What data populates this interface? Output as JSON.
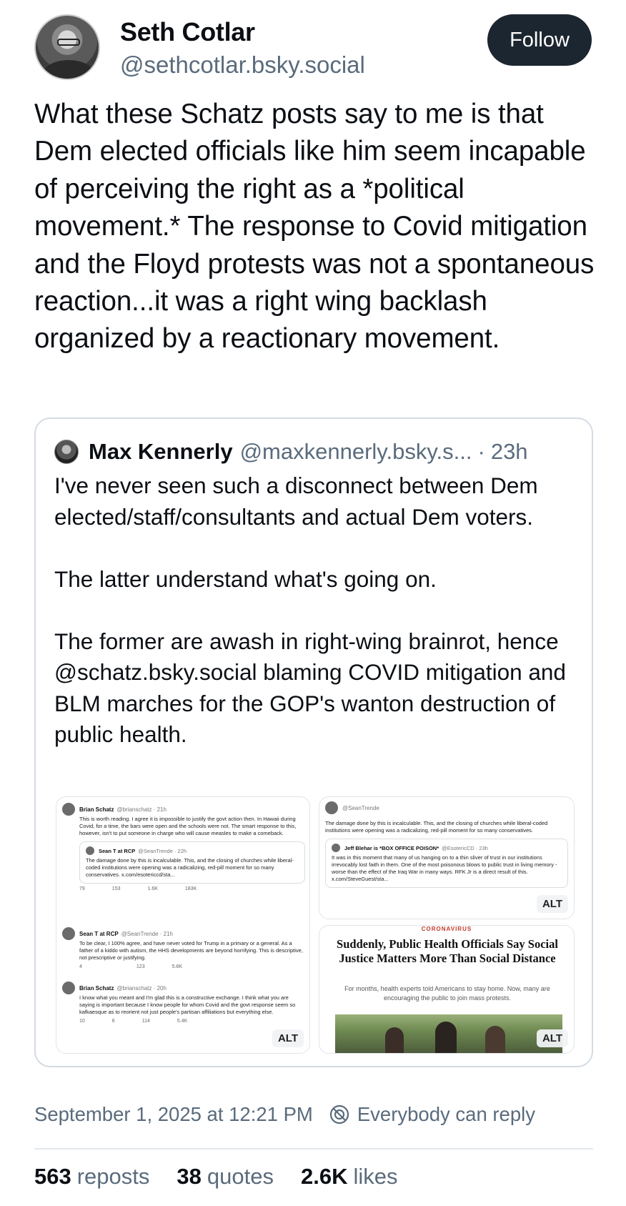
{
  "author": {
    "name": "Seth Cotlar",
    "handle": "@sethcotlar.bsky.social",
    "follow_label": "Follow"
  },
  "post": {
    "text": "What these Schatz posts say to me is that Dem elected officials like him seem incapable of perceiving the right as a *political movement.* The response to Covid mitigation and the Floyd protests was not a spontaneous reaction...it was a right wing backlash organized by a reactionary movement."
  },
  "quote": {
    "name": "Max Kennerly",
    "handle": "@maxkennerly.bsky.s...",
    "separator": "·",
    "time": "23h",
    "text": "I've never seen such a disconnect between Dem elected/staff/consultants and actual Dem voters.\n\nThe latter understand what's going on.\n\nThe former are awash in right-wing brainrot, hence @schatz.bsky.social blaming COVID mitigation and BLM marches for the GOP's wanton destruction of public health."
  },
  "images": {
    "alt_label": "ALT",
    "left": {
      "tweets": [
        {
          "name": "Brian Schatz",
          "meta": "@brianschatz · 21h",
          "body": "This is worth reading. I agree it is impossible to justify the govt action then. In Hawaii during Covid, for a time, the bars were open and the schools were not. The smart response to this, however, isn't to put someone in charge who will cause measles to make a comeback.",
          "embed_name": "Sean T at RCP",
          "embed_meta": "@SeanTrende · 22h",
          "embed_body": "The damage done by this is incalculable. This, and the closing of churches while liberal-coded institutions were opening was a radicalizing, red-pill moment for so many conservatives. x.com/esotericcd/sta...",
          "stats": [
            "79",
            "153",
            "1.6K",
            "183K"
          ]
        },
        {
          "name": "Sean T at RCP",
          "meta": "@SeanTrende · 21h",
          "body": "To be clear, I 100% agree, and have never voted for Trump in a primary or a general. As a father of a kiddo with autism, the HHS developments are beyond horrifying. This is descriptive, not prescriptive or justifying.",
          "stats": [
            "4",
            "",
            "123",
            "5.8K"
          ]
        },
        {
          "name": "Brian Schatz",
          "meta": "@brianschatz · 20h",
          "body": "I know what you meant and I'm glad this is a constructive exchange. I think what you are saying is important because I know people for whom Covid and the govt response seem so kafkaesque as to reorient not just people's partisan affiliations but everything else.",
          "stats": [
            "10",
            "6",
            "114",
            "5.4K"
          ]
        }
      ]
    },
    "right_top": {
      "meta": "@SeanTrende",
      "body": "The damage done by this is incalculable. This, and the closing of churches while liberal-coded institutions were opening was a radicalizing, red-pill moment for so many conservatives.",
      "embed_name": "Jeff Blehar is *BOX OFFICE POISON*",
      "embed_meta": "@EsotericCD · 23h",
      "embed_body": "It was in this moment that many of us hanging on to a thin sliver of trust in our institutions irrevocably lost faith in them. One of the most poisonous blows to public trust in living memory - worse than the effect of the Iraq War in many ways. RFK Jr is a direct result of this. x.com/SteveGuest/sta..."
    },
    "right_bottom": {
      "kicker": "CORONAVIRUS",
      "headline": "Suddenly, Public Health Officials Say Social Justice Matters More Than Social Distance",
      "dek": "For months, health experts told Americans to stay home. Now, many are encouraging the public to join mass protests."
    }
  },
  "meta": {
    "timestamp": "September 1, 2025 at 12:21 PM",
    "reply_setting": "Everybody can reply"
  },
  "stats": {
    "reposts_count": "563",
    "reposts_label": "reposts",
    "quotes_count": "38",
    "quotes_label": "quotes",
    "likes_count": "2.6K",
    "likes_label": "likes"
  },
  "colors": {
    "text": "#0b0f14",
    "muted": "#5a6b7c",
    "follow_bg": "#1c2630",
    "border": "#d4dbe2"
  }
}
